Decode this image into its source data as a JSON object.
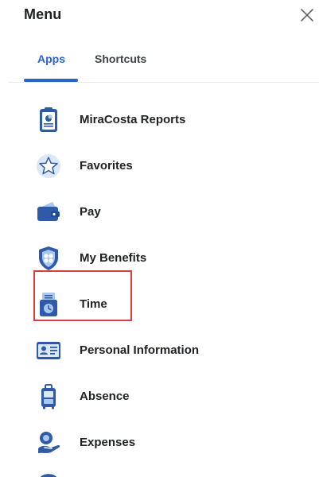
{
  "header": {
    "title": "Menu"
  },
  "tabs": [
    {
      "label": "Apps",
      "active": true
    },
    {
      "label": "Shortcuts",
      "active": false
    }
  ],
  "menu": {
    "items": [
      {
        "label": "MiraCosta Reports",
        "icon": "report-clipboard-icon"
      },
      {
        "label": "Favorites",
        "icon": "star-icon"
      },
      {
        "label": "Pay",
        "icon": "wallet-icon"
      },
      {
        "label": "My Benefits",
        "icon": "shield-icon"
      },
      {
        "label": "Time",
        "icon": "time-clock-icon",
        "highlighted": true
      },
      {
        "label": "Personal Information",
        "icon": "id-card-icon"
      },
      {
        "label": "Absence",
        "icon": "luggage-icon"
      },
      {
        "label": "Expenses",
        "icon": "expenses-icon"
      }
    ]
  },
  "colors": {
    "accent": "#2b63cf",
    "highlight_border": "#d83d42",
    "icon_blue_dark": "#2f5aa8",
    "icon_blue_light": "#a9c8ee"
  }
}
